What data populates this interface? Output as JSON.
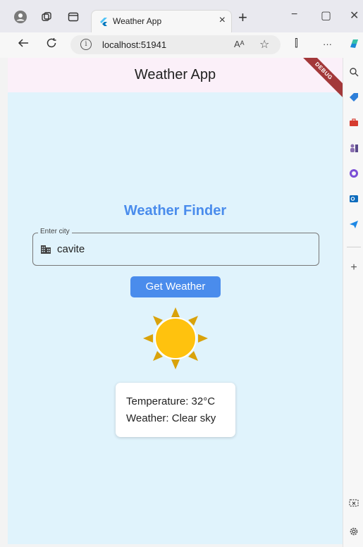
{
  "browser": {
    "tab_title": "Weather App",
    "tab_close": "×",
    "new_tab": "+",
    "url": "localhost:51941",
    "read_aloud": "Aᴬ",
    "favorite": "☆",
    "split": "⫿",
    "more": "···",
    "window": {
      "minimize": "−",
      "maximize": "▢",
      "close": "✕"
    }
  },
  "app": {
    "title": "Weather App",
    "debug_banner": "DEBUG",
    "heading": "Weather Finder",
    "city_field": {
      "label": "Enter city",
      "value": "cavite"
    },
    "button_label": "Get Weather",
    "weather_icon": "sun-icon",
    "result": {
      "temperature": "Temperature: 32°C",
      "weather": "Weather: Clear sky"
    }
  },
  "colors": {
    "accent": "#4a8cec",
    "background": "#e0f3fc",
    "appbar": "#fbf0f9",
    "sun": "#ffc20e",
    "sun_rays": "#d9a20a",
    "debug": "#a3383a"
  }
}
